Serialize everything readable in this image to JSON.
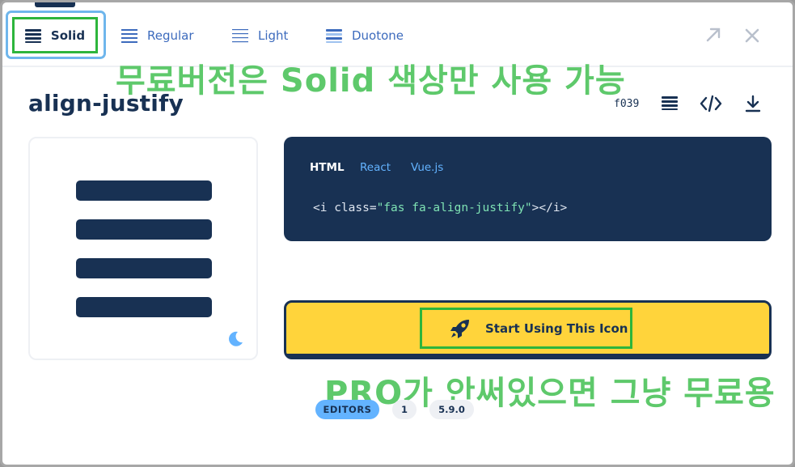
{
  "tabs": [
    {
      "label": "Solid",
      "icon": "align-justify-icon",
      "active": true
    },
    {
      "label": "Regular",
      "icon": "align-justify-icon"
    },
    {
      "label": "Light",
      "icon": "align-justify-icon"
    },
    {
      "label": "Duotone",
      "icon": "align-justify-icon"
    }
  ],
  "window_icons": {
    "expand": "expand-icon",
    "close": "close-icon"
  },
  "annotations": {
    "top": "무료버전은 Solid 색상만 사용 가능",
    "bottom": "PRO가 안써있으면 그냥 무료용"
  },
  "icon": {
    "name": "align-justify",
    "unicode": "f039",
    "actions": [
      "align-justify-icon",
      "code-icon",
      "download-icon"
    ]
  },
  "preview": {
    "theme_icon": "moon-icon"
  },
  "code": {
    "tabs": [
      "HTML",
      "React",
      "Vue.js"
    ],
    "active_tab": "HTML",
    "snippet_open": "<i class=",
    "snippet_value": "\"fas fa-align-justify\"",
    "snippet_close": "></i>"
  },
  "start_button": {
    "label": "Start Using This Icon",
    "icon": "rocket-icon"
  },
  "badges": [
    "EDITORS",
    "1",
    "5.9.0"
  ],
  "colors": {
    "navy": "#183153",
    "accent_blue": "#63b3ff",
    "button_yellow": "#ffd43b",
    "annotation_green": "#5ec96b",
    "highlight_green": "#2db53c"
  }
}
